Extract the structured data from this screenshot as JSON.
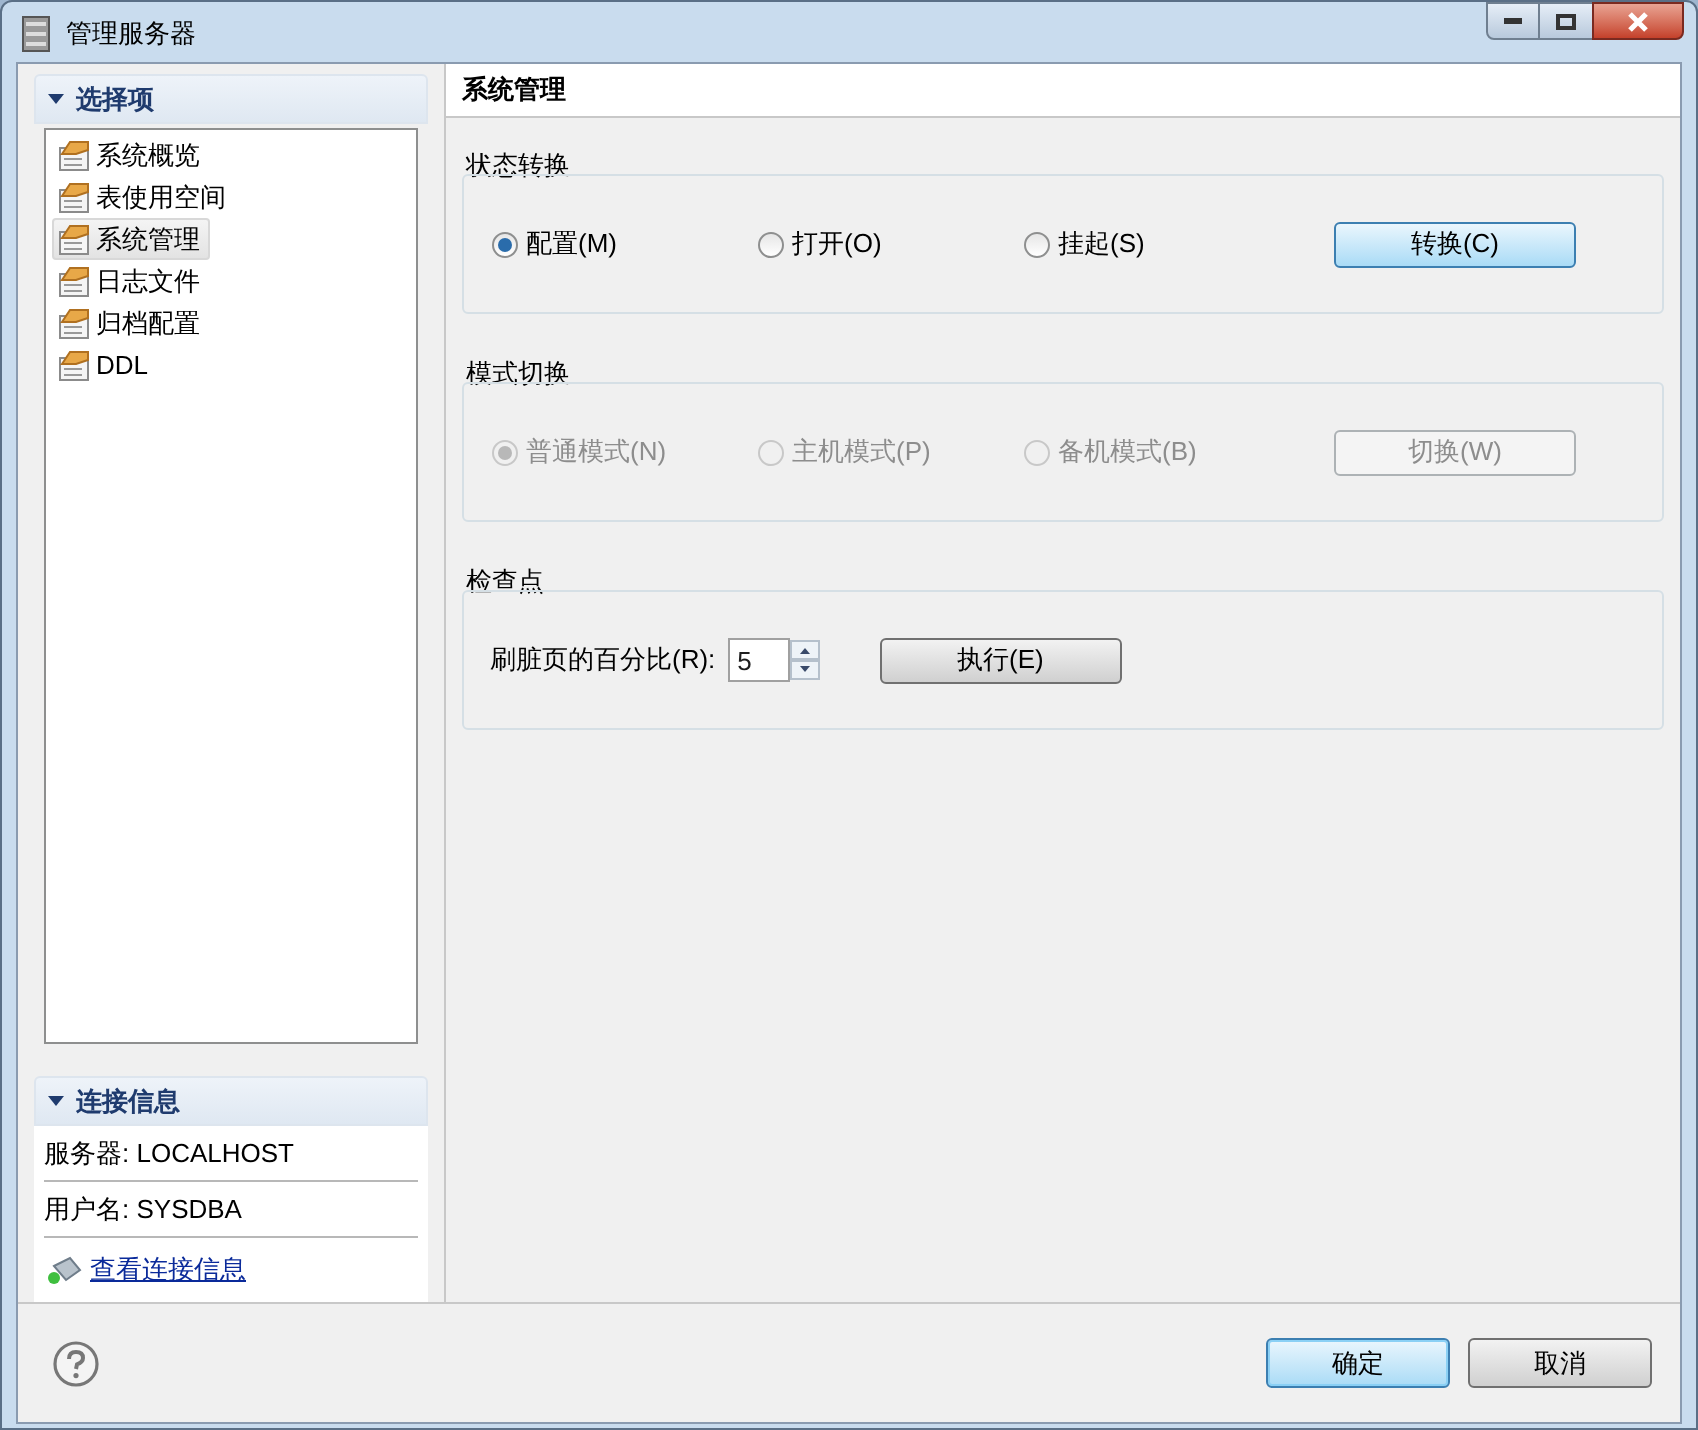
{
  "window": {
    "title": "管理服务器"
  },
  "sidebar": {
    "options_header": "选择项",
    "items": [
      {
        "label": "系统概览",
        "selected": false
      },
      {
        "label": "表使用空间",
        "selected": false
      },
      {
        "label": "系统管理",
        "selected": true
      },
      {
        "label": "日志文件",
        "selected": false
      },
      {
        "label": "归档配置",
        "selected": false
      },
      {
        "label": "DDL",
        "selected": false
      }
    ],
    "connection": {
      "header": "连接信息",
      "rows": [
        "服务器: LOCALHOST",
        "用户名: SYSDBA"
      ],
      "link": "查看连接信息"
    }
  },
  "panel": {
    "title": "系统管理",
    "groups": [
      {
        "kind": "radio",
        "title": "状态转换",
        "disabled": false,
        "options": [
          {
            "label": "配置(M)",
            "selected": true
          },
          {
            "label": "打开(O)",
            "selected": false
          },
          {
            "label": "挂起(S)",
            "selected": false
          }
        ],
        "button": "转换(C)",
        "button_focused": true
      },
      {
        "kind": "radio",
        "title": "模式切换",
        "disabled": true,
        "options": [
          {
            "label": "普通模式(N)",
            "selected": true
          },
          {
            "label": "主机模式(P)",
            "selected": false
          },
          {
            "label": "备机模式(B)",
            "selected": false
          }
        ],
        "button": "切换(W)",
        "button_focused": false
      },
      {
        "kind": "spinner",
        "title": "检查点",
        "label": "刷脏页的百分比(R):",
        "value": "5",
        "button": "执行(E)"
      }
    ]
  },
  "footer": {
    "buttons": [
      {
        "label": "确定",
        "default": true
      },
      {
        "label": "取消",
        "default": false
      }
    ]
  }
}
